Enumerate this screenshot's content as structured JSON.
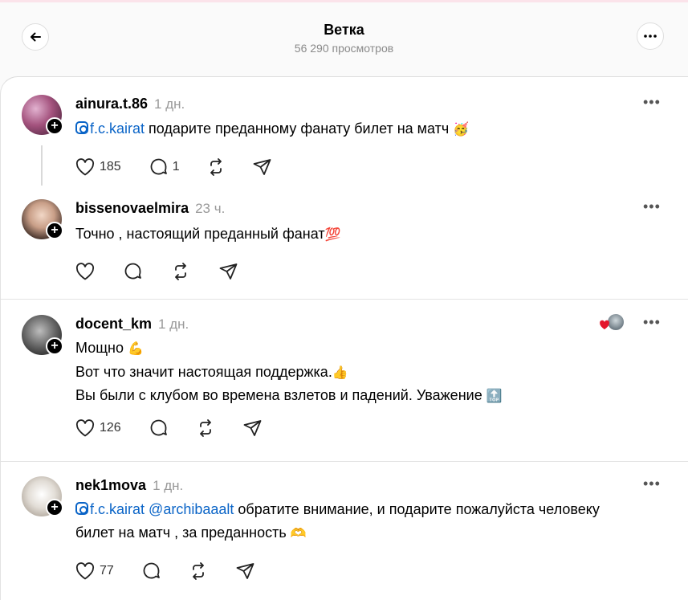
{
  "header": {
    "title": "Ветка",
    "views": "56 290 просмотров"
  },
  "posts": [
    {
      "username": "ainura.t.86",
      "time": "1 дн.",
      "mention": "f.c.kairat",
      "text": " подарите преданному фанату билет на матч ",
      "emoji": "🥳",
      "likes": "185",
      "replies": "1"
    },
    {
      "username": "bissenovaelmira",
      "time": "23 ч.",
      "text": "Точно , настоящий преданный фанат",
      "emoji": "💯"
    },
    {
      "username": "docent_km",
      "time": "1 дн.",
      "lines": [
        "Мощно ",
        "Вот что значит настоящая поддержка.",
        "Вы были с клубом во времена взлетов и падений. Уважение "
      ],
      "emojis": [
        "💪",
        "👍",
        "🔝"
      ],
      "likes": "126"
    },
    {
      "username": "nek1mova",
      "time": "1 дн.",
      "mention": "f.c.kairat",
      "mention2": "@archibaaalt",
      "text1": " обратите внимание, и подарите пожалуйста человеку",
      "text2": "билет на матч , за преданность ",
      "emoji": "🫶",
      "likes": "77"
    }
  ],
  "icons": {
    "back": "arrow-left-icon",
    "more": "more-horizontal-icon",
    "like": "heart-icon",
    "reply": "comment-icon",
    "repost": "repost-icon",
    "share": "send-icon",
    "follow": "plus-icon",
    "instagram": "instagram-icon"
  },
  "colors": {
    "link": "#0a64c7",
    "muted": "#999999",
    "accent": "#000000"
  }
}
